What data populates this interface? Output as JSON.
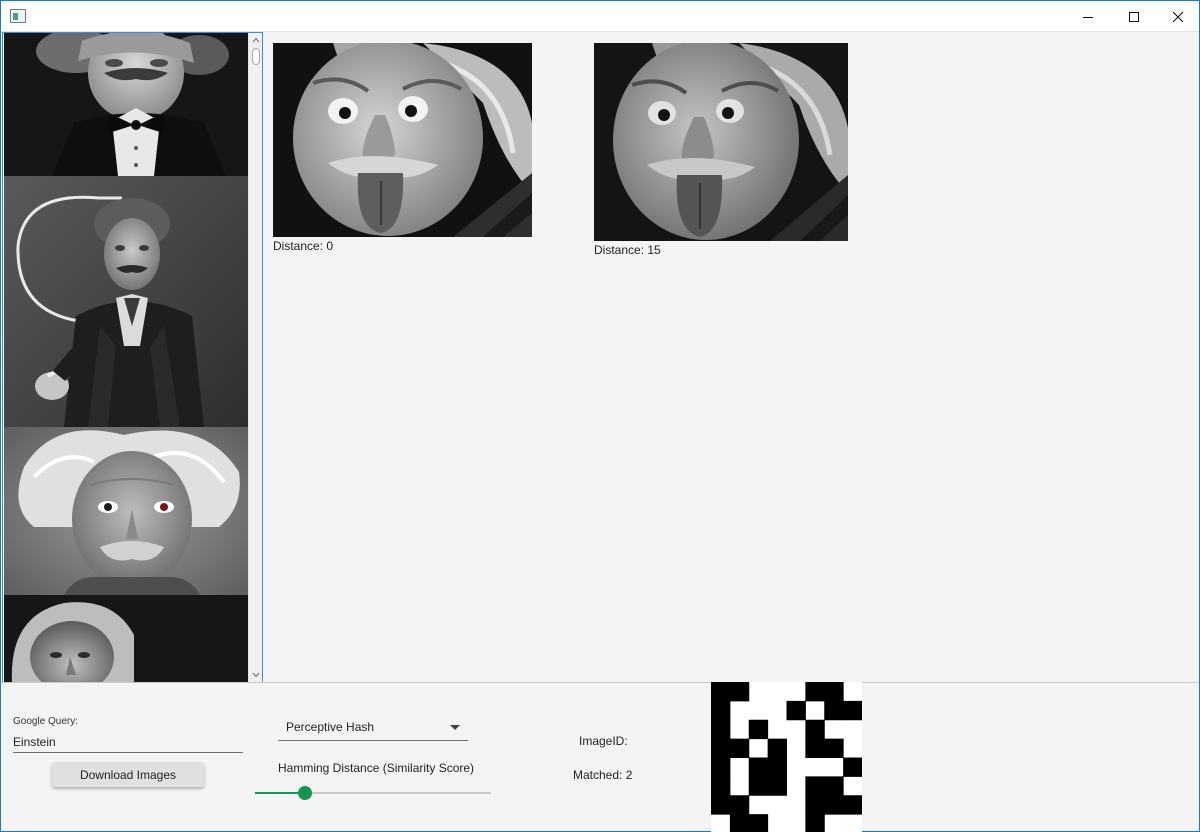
{
  "window": {
    "minimize_icon": "minimize-icon",
    "maximize_icon": "maximize-icon",
    "close_icon": "close-icon"
  },
  "thumbnails": [
    {
      "name": "thumbnail-1",
      "subject": "man in tuxedo with bow tie, dark background"
    },
    {
      "name": "thumbnail-2",
      "subject": "man in suit standing before a chalkboard, holding chalk"
    },
    {
      "name": "thumbnail-3",
      "subject": "close-up portrait with white hair and moustache"
    },
    {
      "name": "thumbnail-4",
      "subject": "portrait on a dark background"
    }
  ],
  "results": [
    {
      "caption": "Distance: 0",
      "distance": 0
    },
    {
      "caption": "Distance: 15",
      "distance": 15
    }
  ],
  "controls": {
    "query_label": "Google Query:",
    "query_value": "Einstein",
    "download_label": "Download Images",
    "hash_algorithm": "Perceptive Hash",
    "hamming_label": "Hamming Distance (Similarity Score)",
    "hamming_fraction": 0.21,
    "image_id_label": "ImageID:",
    "matched_label": "Matched: 2",
    "accent_color": "#17944f"
  },
  "hash_bits": [
    [
      1,
      1,
      0,
      0,
      0,
      1,
      1,
      0
    ],
    [
      1,
      0,
      0,
      0,
      1,
      0,
      1,
      1
    ],
    [
      1,
      0,
      1,
      0,
      0,
      1,
      0,
      0
    ],
    [
      1,
      1,
      0,
      1,
      0,
      1,
      1,
      0
    ],
    [
      1,
      0,
      1,
      1,
      0,
      0,
      0,
      1
    ],
    [
      1,
      0,
      1,
      1,
      0,
      1,
      1,
      0
    ],
    [
      1,
      1,
      0,
      0,
      0,
      1,
      1,
      1
    ],
    [
      0,
      1,
      1,
      0,
      0,
      1,
      0,
      0
    ]
  ]
}
